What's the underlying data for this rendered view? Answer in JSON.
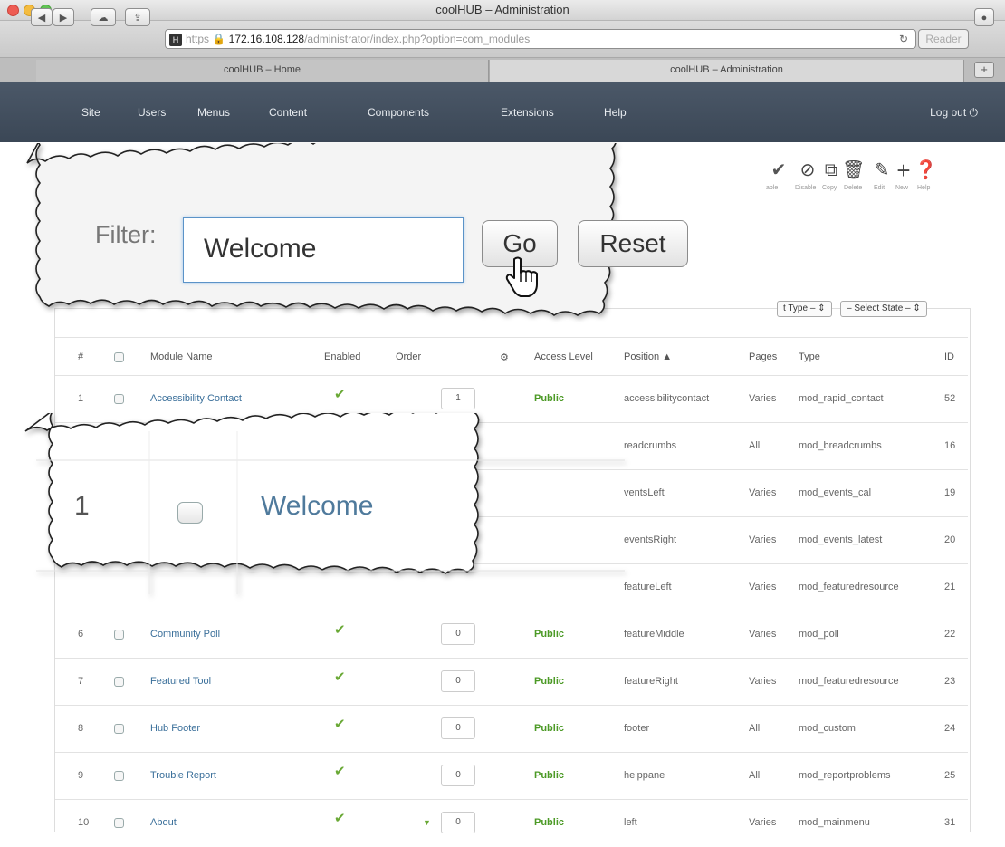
{
  "window": {
    "title": "coolHUB – Administration"
  },
  "browser": {
    "url_prefix": "https",
    "url_host": "172.16.108.128",
    "url_path": "/administrator/index.php?option=com_modules",
    "reader_label": "Reader",
    "tabs": [
      "coolHUB – Home",
      "coolHUB – Administration"
    ],
    "new_tab_label": "+"
  },
  "nav": {
    "items": [
      "Site",
      "Users",
      "Menus",
      "Content",
      "Components",
      "Extensions",
      "Help"
    ],
    "logout": "Log out"
  },
  "toolbar_actions": {
    "labels": [
      "able",
      "Disable",
      "Copy",
      "Delete",
      "Edit",
      "New",
      "Help"
    ]
  },
  "filters": {
    "type_select": "t Type –",
    "state_select": "– Select State –"
  },
  "table": {
    "headers": [
      "#",
      "Module Name",
      "Enabled",
      "Order",
      "Access Level",
      "Position ▲",
      "Pages",
      "Type",
      "ID"
    ],
    "rows": [
      {
        "num": "1",
        "name": "Accessibility Contact",
        "order": "1",
        "access": "Public",
        "position": "accessibilitycontact",
        "pages": "Varies",
        "type": "mod_rapid_contact",
        "id": "52"
      },
      {
        "num": "",
        "name": "",
        "order": "",
        "access": "",
        "position": "readcrumbs",
        "pages": "All",
        "type": "mod_breadcrumbs",
        "id": "16"
      },
      {
        "num": "",
        "name": "",
        "order": "",
        "access": "",
        "position": "ventsLeft",
        "pages": "Varies",
        "type": "mod_events_cal",
        "id": "19"
      },
      {
        "num": "",
        "name": "",
        "order": "",
        "access": "",
        "position": "eventsRight",
        "pages": "Varies",
        "type": "mod_events_latest",
        "id": "20"
      },
      {
        "num": "",
        "name": "",
        "order": "",
        "access": "",
        "position": "featureLeft",
        "pages": "Varies",
        "type": "mod_featuredresource",
        "id": "21"
      },
      {
        "num": "6",
        "name": "Community Poll",
        "order": "0",
        "access": "Public",
        "position": "featureMiddle",
        "pages": "Varies",
        "type": "mod_poll",
        "id": "22"
      },
      {
        "num": "7",
        "name": "Featured Tool",
        "order": "0",
        "access": "Public",
        "position": "featureRight",
        "pages": "Varies",
        "type": "mod_featuredresource",
        "id": "23"
      },
      {
        "num": "8",
        "name": "Hub Footer",
        "order": "0",
        "access": "Public",
        "position": "footer",
        "pages": "All",
        "type": "mod_custom",
        "id": "24"
      },
      {
        "num": "9",
        "name": "Trouble Report",
        "order": "0",
        "access": "Public",
        "position": "helppane",
        "pages": "All",
        "type": "mod_reportproblems",
        "id": "25"
      },
      {
        "num": "10",
        "name": "About",
        "order": "0",
        "access": "Public",
        "position": "left",
        "pages": "Varies",
        "type": "mod_mainmenu",
        "id": "31"
      }
    ]
  },
  "callout_filter": {
    "label": "Filter:",
    "value": "Welcome",
    "go_label": "Go",
    "reset_label": "Reset"
  },
  "callout_result": {
    "num": "1",
    "name": "Welcome"
  },
  "colors": {
    "navbar": "#3f4b5a",
    "link": "#3a6f9a",
    "public": "#4c9a26",
    "tick": "#6aa936",
    "focus": "#5b93c8"
  }
}
